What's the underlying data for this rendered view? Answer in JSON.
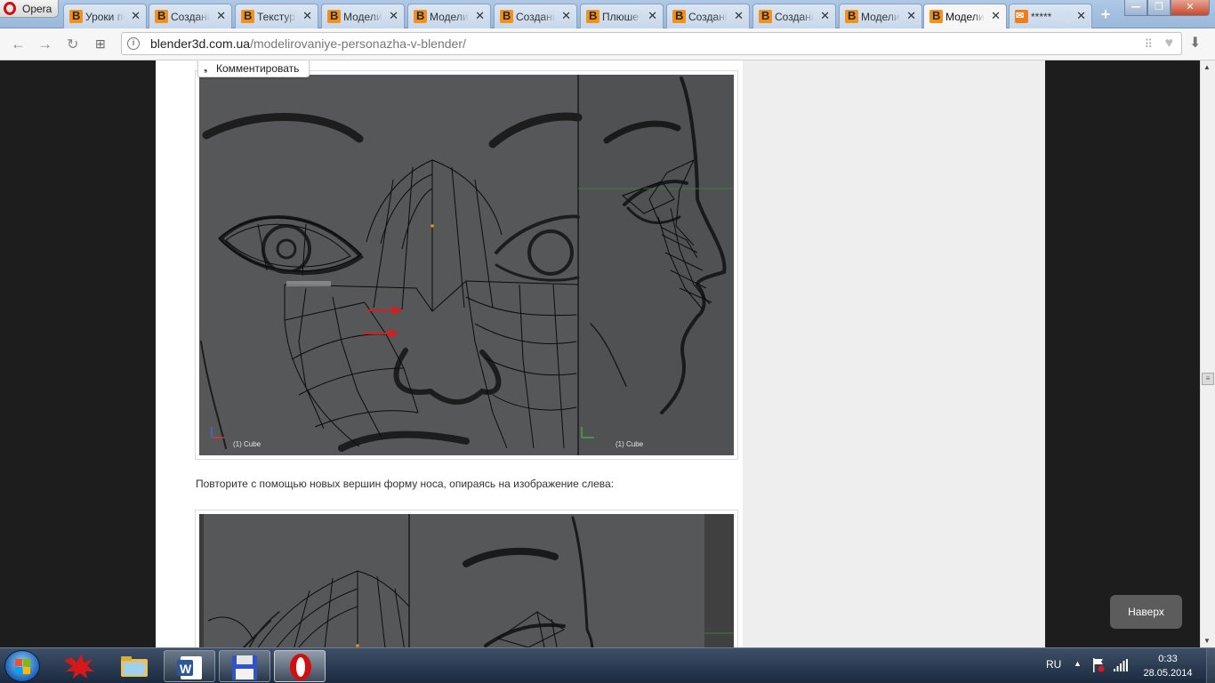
{
  "browser": {
    "name": "Opera",
    "tabs": [
      {
        "title": "Уроки по",
        "icon": "blender3d-favicon"
      },
      {
        "title": "Создание",
        "icon": "blender3d-favicon"
      },
      {
        "title": "Текстур",
        "icon": "blender3d-favicon"
      },
      {
        "title": "Моделир",
        "icon": "blender3d-favicon"
      },
      {
        "title": "Моделир",
        "icon": "blender3d-favicon"
      },
      {
        "title": "Создание",
        "icon": "blender3d-favicon"
      },
      {
        "title": "Плюше",
        "icon": "blender3d-favicon"
      },
      {
        "title": "Создание",
        "icon": "blender3d-favicon"
      },
      {
        "title": "Создание",
        "icon": "blender3d-favicon"
      },
      {
        "title": "Моделир",
        "icon": "blender3d-favicon"
      },
      {
        "title": "Моделир",
        "icon": "blender3d-favicon",
        "active": true
      },
      {
        "title": "*****",
        "icon": "mail-favicon"
      }
    ],
    "new_tab_label": "+",
    "close_glyph": "✕"
  },
  "address": {
    "domain": "blender3d.com.ua",
    "path": "/modelirovaniye-personazha-v-blender/"
  },
  "page": {
    "comment_button": "Комментировать",
    "image1": {
      "left_label": "(1) Cube",
      "right_label": "(1) Cube"
    },
    "caption": "Повторите с помощью новых вершин форму носа, опираясь на изображение слева:",
    "to_top": "Наверх"
  },
  "taskbar": {
    "language": "RU",
    "time": "0:33",
    "date": "28.05.2014"
  },
  "colors": {
    "accent_orange": "#f2911b",
    "viewport_gray": "#555759",
    "wire": "#0c0c0c"
  }
}
